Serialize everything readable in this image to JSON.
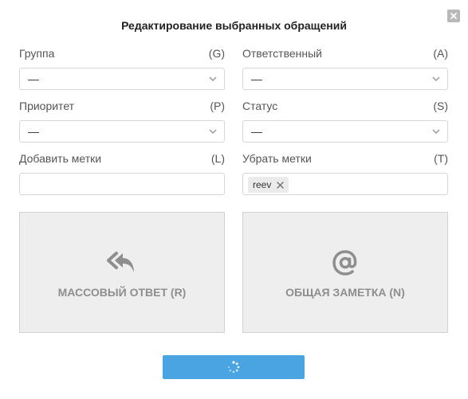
{
  "dialog": {
    "title": "Редактирование выбранных обращений"
  },
  "fields": {
    "group": {
      "label": "Группа",
      "shortcut": "(G)",
      "value": "—"
    },
    "assignee": {
      "label": "Ответственный",
      "shortcut": "(A)",
      "value": "—"
    },
    "priority": {
      "label": "Приоритет",
      "shortcut": "(P)",
      "value": "—"
    },
    "status": {
      "label": "Статус",
      "shortcut": "(S)",
      "value": "—"
    },
    "add_tags": {
      "label": "Добавить метки",
      "shortcut": "(L)",
      "value": ""
    },
    "remove_tags": {
      "label": "Убрать метки",
      "shortcut": "(T)",
      "tags": [
        "reev"
      ]
    }
  },
  "actions": {
    "mass_reply": {
      "label": "МАССОВЫЙ ОТВЕТ (R)",
      "icon": "reply-all-icon"
    },
    "common_note": {
      "label": "ОБЩАЯ ЗАМЕТКА (N)",
      "icon": "at-sign-icon"
    },
    "submit": {
      "state": "loading",
      "icon": "spinner-icon"
    }
  },
  "colors": {
    "submit_bg": "#4aa4e2",
    "tile_bg": "#eeeeee",
    "tile_text": "#8e8e8e"
  }
}
